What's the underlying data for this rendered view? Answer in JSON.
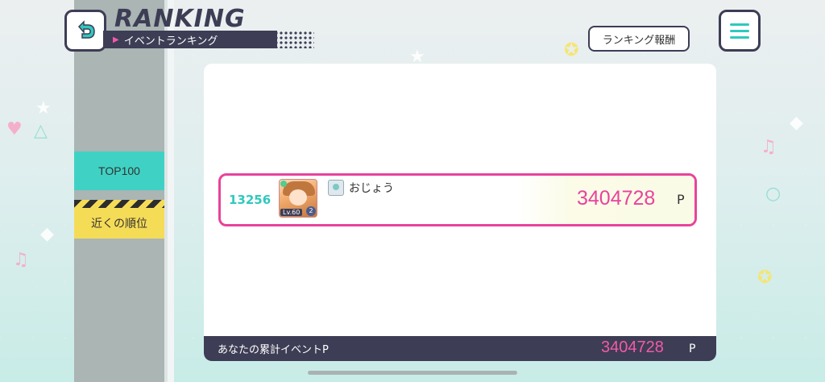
{
  "header": {
    "title": "RANKING",
    "subtitle": "イベントランキング",
    "reward_button": "ランキング報酬",
    "back_icon": "back-arrow-icon",
    "menu_icon": "hamburger-menu-icon"
  },
  "sidebar": {
    "items": [
      {
        "label": "TOP100"
      },
      {
        "label": "近くの順位"
      }
    ]
  },
  "ranking": {
    "entry": {
      "rank": "13256",
      "level": "Lv.60",
      "rank_badge": "2",
      "name": "おじょう",
      "score": "3404728",
      "unit": "P"
    }
  },
  "footer": {
    "label": "あなたの累計イベントP",
    "score": "3404728",
    "unit": "P"
  },
  "colors": {
    "accent_teal": "#2fc9bd",
    "accent_pink": "#e8439b",
    "navy": "#3d3d55",
    "yellow": "#f5dc57"
  }
}
